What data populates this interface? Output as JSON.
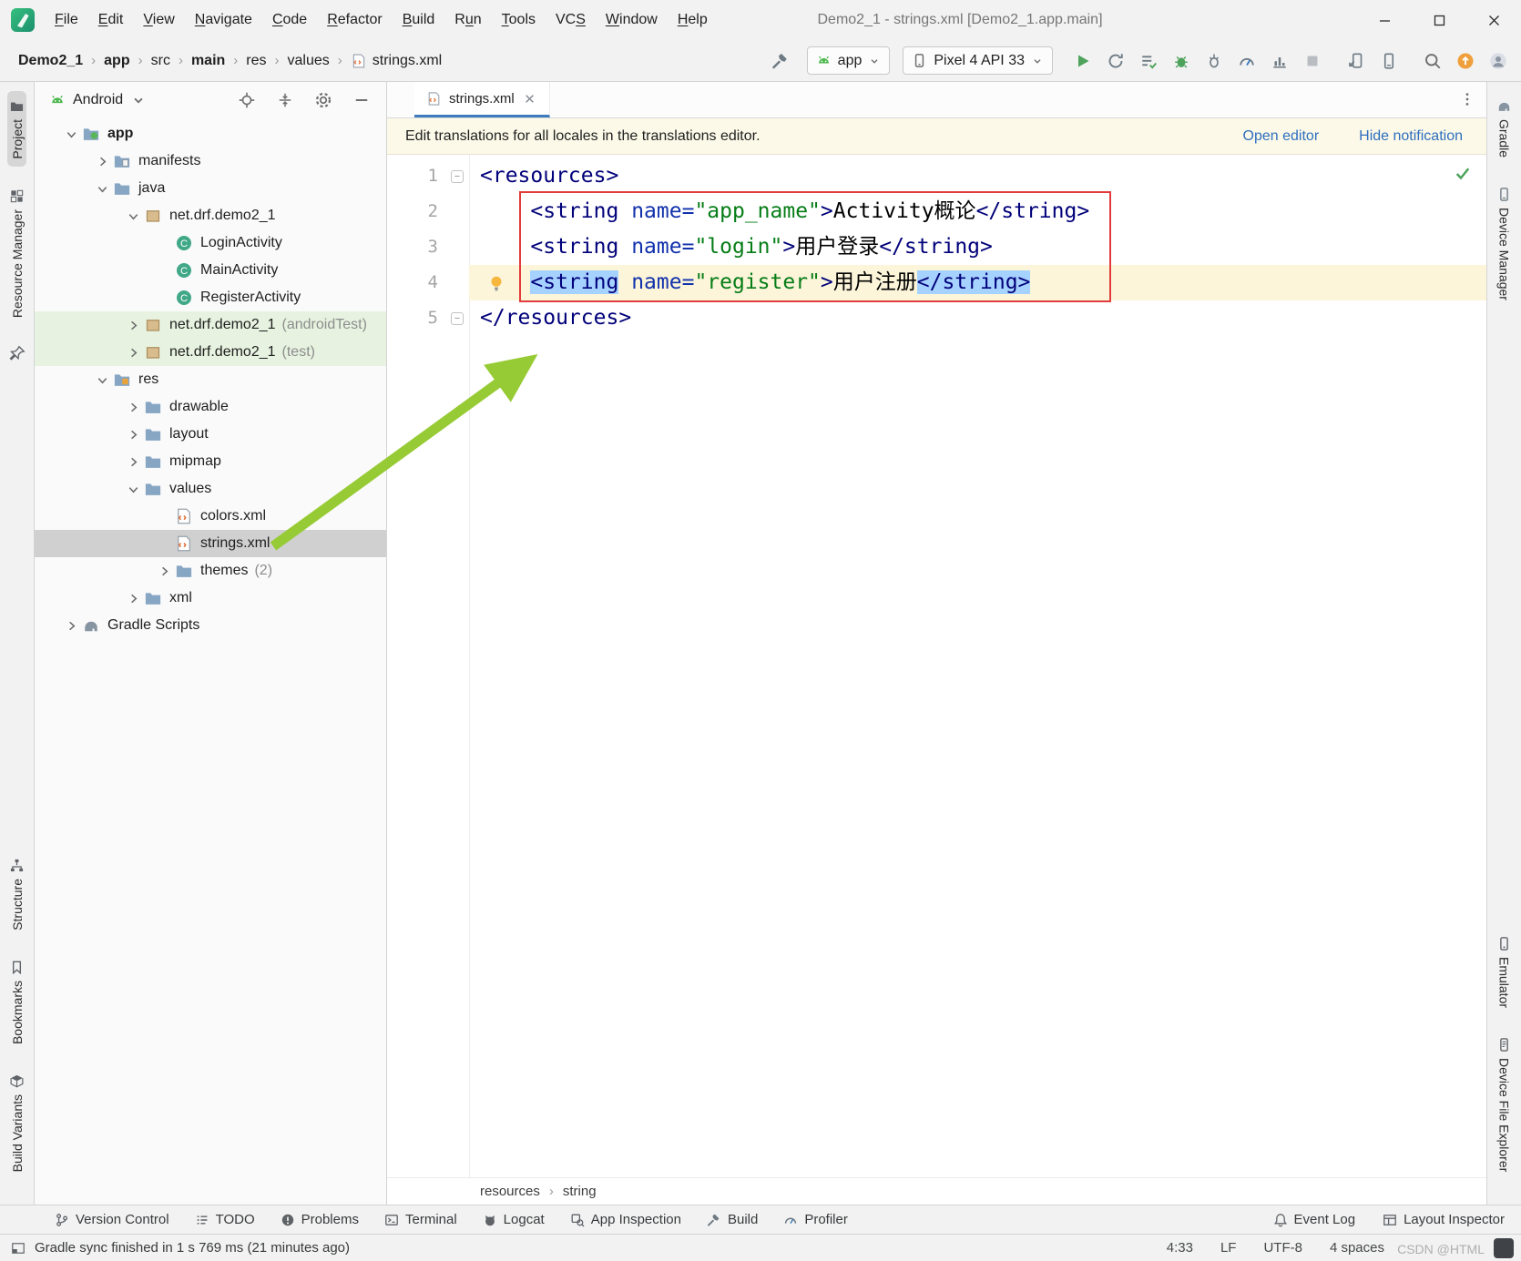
{
  "window": {
    "title": "Demo2_1 - strings.xml [Demo2_1.app.main]",
    "controls": [
      "minimize",
      "maximize",
      "close"
    ]
  },
  "menubar": {
    "items": [
      {
        "label": "File",
        "u": 0
      },
      {
        "label": "Edit",
        "u": 0
      },
      {
        "label": "View",
        "u": 0
      },
      {
        "label": "Navigate",
        "u": 0
      },
      {
        "label": "Code",
        "u": 0
      },
      {
        "label": "Refactor",
        "u": 0
      },
      {
        "label": "Build",
        "u": 0
      },
      {
        "label": "Run",
        "u": 1
      },
      {
        "label": "Tools",
        "u": 0
      },
      {
        "label": "VCS",
        "u": 2
      },
      {
        "label": "Window",
        "u": 0
      },
      {
        "label": "Help",
        "u": 0
      }
    ]
  },
  "toolbar": {
    "breadcrumbs": [
      {
        "label": "Demo2_1",
        "bold": true
      },
      {
        "label": "app",
        "bold": true
      },
      {
        "label": "src"
      },
      {
        "label": "main",
        "bold": true
      },
      {
        "label": "res"
      },
      {
        "label": "values"
      },
      {
        "label": "strings.xml",
        "icon": "xml-file"
      }
    ],
    "build_icon": "build-hammer",
    "run_config": {
      "label": "app",
      "icon": "android"
    },
    "device": {
      "label": "Pixel 4 API 33",
      "icon": "phone"
    },
    "run_icons": [
      "run",
      "apply-changes",
      "apply-code-changes",
      "debug",
      "attach-debugger",
      "profiler",
      "profile-app",
      "stop"
    ],
    "device_icons": [
      "device-mirror",
      "device-manager"
    ],
    "end_icons": [
      "search",
      "updates",
      "avatar"
    ]
  },
  "left_stripe": {
    "top": [
      {
        "label": "Project",
        "icon": "project-folder",
        "selected": true
      },
      {
        "label": "Resource Manager",
        "icon": "resource-manager"
      }
    ],
    "pin_icon": "pin",
    "bottom": [
      {
        "label": "Structure",
        "icon": "structure"
      },
      {
        "label": "Bookmarks",
        "icon": "bookmark"
      },
      {
        "label": "Build Variants",
        "icon": "build-variants"
      }
    ]
  },
  "right_stripe": {
    "top": [
      {
        "label": "Gradle",
        "icon": "gradle"
      },
      {
        "label": "Device Manager",
        "icon": "device-manager"
      }
    ],
    "bottom": [
      {
        "label": "Emulator",
        "icon": "emulator"
      },
      {
        "label": "Device File Explorer",
        "icon": "device-explorer"
      }
    ]
  },
  "project": {
    "selector": "Android",
    "header_icons": [
      "locate",
      "collapse-all",
      "settings",
      "hide"
    ],
    "tree": [
      {
        "label": "app",
        "level": 0,
        "chevron": "down",
        "icon": "folder-app",
        "bold": true
      },
      {
        "label": "manifests",
        "level": 1,
        "chevron": "right",
        "icon": "folder-manifest"
      },
      {
        "label": "java",
        "level": 1,
        "chevron": "down",
        "icon": "folder"
      },
      {
        "label": "net.drf.demo2_1",
        "level": 2,
        "chevron": "down",
        "icon": "package"
      },
      {
        "label": "LoginActivity",
        "level": 3,
        "icon": "class"
      },
      {
        "label": "MainActivity",
        "level": 3,
        "icon": "class"
      },
      {
        "label": "RegisterActivity",
        "level": 3,
        "icon": "class"
      },
      {
        "label": "net.drf.demo2_1",
        "suffix": "(androidTest)",
        "level": 2,
        "chevron": "right",
        "icon": "package",
        "highlight": true
      },
      {
        "label": "net.drf.demo2_1",
        "suffix": "(test)",
        "level": 2,
        "chevron": "right",
        "icon": "package",
        "highlight": true
      },
      {
        "label": "res",
        "level": 1,
        "chevron": "down",
        "icon": "folder-res"
      },
      {
        "label": "drawable",
        "level": 2,
        "chevron": "right",
        "icon": "folder"
      },
      {
        "label": "layout",
        "level": 2,
        "chevron": "right",
        "icon": "folder"
      },
      {
        "label": "mipmap",
        "level": 2,
        "chevron": "right",
        "icon": "folder"
      },
      {
        "label": "values",
        "level": 2,
        "chevron": "down",
        "icon": "folder"
      },
      {
        "label": "colors.xml",
        "level": 3,
        "icon": "xml-file"
      },
      {
        "label": "strings.xml",
        "level": 3,
        "icon": "xml-file",
        "selected": true
      },
      {
        "label": "themes",
        "suffix": "(2)",
        "level": 3,
        "chevron": "right",
        "icon": "folder"
      },
      {
        "label": "xml",
        "level": 2,
        "chevron": "right",
        "icon": "folder"
      },
      {
        "label": "Gradle Scripts",
        "level": 0,
        "chevron": "right",
        "icon": "gradle"
      }
    ]
  },
  "editor": {
    "tab": {
      "label": "strings.xml",
      "icon": "xml-file"
    },
    "notification": {
      "text": "Edit translations for all locales in the translations editor.",
      "open_editor": "Open editor",
      "hide": "Hide notification"
    },
    "code_lines": [
      {
        "num": "1",
        "fold": true,
        "tokens": [
          {
            "t": "<resources>",
            "s": "tag"
          }
        ]
      },
      {
        "num": "2",
        "tokens": [
          {
            "t": "    ",
            "s": "text"
          },
          {
            "t": "<string",
            "s": "tag"
          },
          {
            "t": " ",
            "s": "text"
          },
          {
            "t": "name",
            "s": "attr"
          },
          {
            "t": "=",
            "s": "attr"
          },
          {
            "t": "\"app_name\"",
            "s": "value"
          },
          {
            "t": ">",
            "s": "tag"
          },
          {
            "t": "Activity概论",
            "s": "text"
          },
          {
            "t": "</string>",
            "s": "tag"
          }
        ]
      },
      {
        "num": "3",
        "tokens": [
          {
            "t": "    ",
            "s": "text"
          },
          {
            "t": "<string",
            "s": "tag"
          },
          {
            "t": " ",
            "s": "text"
          },
          {
            "t": "name",
            "s": "attr"
          },
          {
            "t": "=",
            "s": "attr"
          },
          {
            "t": "\"login\"",
            "s": "value"
          },
          {
            "t": ">",
            "s": "tag"
          },
          {
            "t": "用户登录",
            "s": "text"
          },
          {
            "t": "</string>",
            "s": "tag"
          }
        ]
      },
      {
        "num": "4",
        "current": true,
        "bulb": true,
        "tokens": [
          {
            "t": "    ",
            "s": "text"
          },
          {
            "t": "<string",
            "s": "tag",
            "hl": true
          },
          {
            "t": " ",
            "s": "text"
          },
          {
            "t": "name",
            "s": "attr"
          },
          {
            "t": "=",
            "s": "attr"
          },
          {
            "t": "\"register\"",
            "s": "value"
          },
          {
            "t": ">",
            "s": "tag"
          },
          {
            "t": "用户注册",
            "s": "text"
          },
          {
            "t": "</string>",
            "s": "tag",
            "hl": true
          }
        ]
      },
      {
        "num": "5",
        "fold": true,
        "tokens": [
          {
            "t": "</resources>",
            "s": "tag"
          }
        ]
      }
    ],
    "breadcrumbs": [
      "resources",
      "string"
    ]
  },
  "bottom_bar": {
    "left": [
      {
        "label": "Version Control",
        "icon": "vcs-branch"
      },
      {
        "label": "TODO",
        "icon": "todo-list"
      },
      {
        "label": "Problems",
        "icon": "problems"
      },
      {
        "label": "Terminal",
        "icon": "terminal"
      },
      {
        "label": "Logcat",
        "icon": "logcat"
      },
      {
        "label": "App Inspection",
        "icon": "app-inspection"
      },
      {
        "label": "Build",
        "icon": "build-hammer"
      },
      {
        "label": "Profiler",
        "icon": "profiler"
      }
    ],
    "right": [
      {
        "label": "Event Log",
        "icon": "event-log"
      },
      {
        "label": "Layout Inspector",
        "icon": "layout-inspector"
      }
    ]
  },
  "status_bar": {
    "toggle_icon": "panel-toggle",
    "message": "Gradle sync finished in 1 s 769 ms (21 minutes ago)",
    "caret_position": "4:33",
    "line_separator": "LF",
    "encoding": "UTF-8",
    "indent": "4 spaces",
    "watermark": "CSDN @HTML"
  },
  "annotations": {
    "red_box_color": "#E23B3B",
    "green_arrow_color": "#97CB35"
  }
}
